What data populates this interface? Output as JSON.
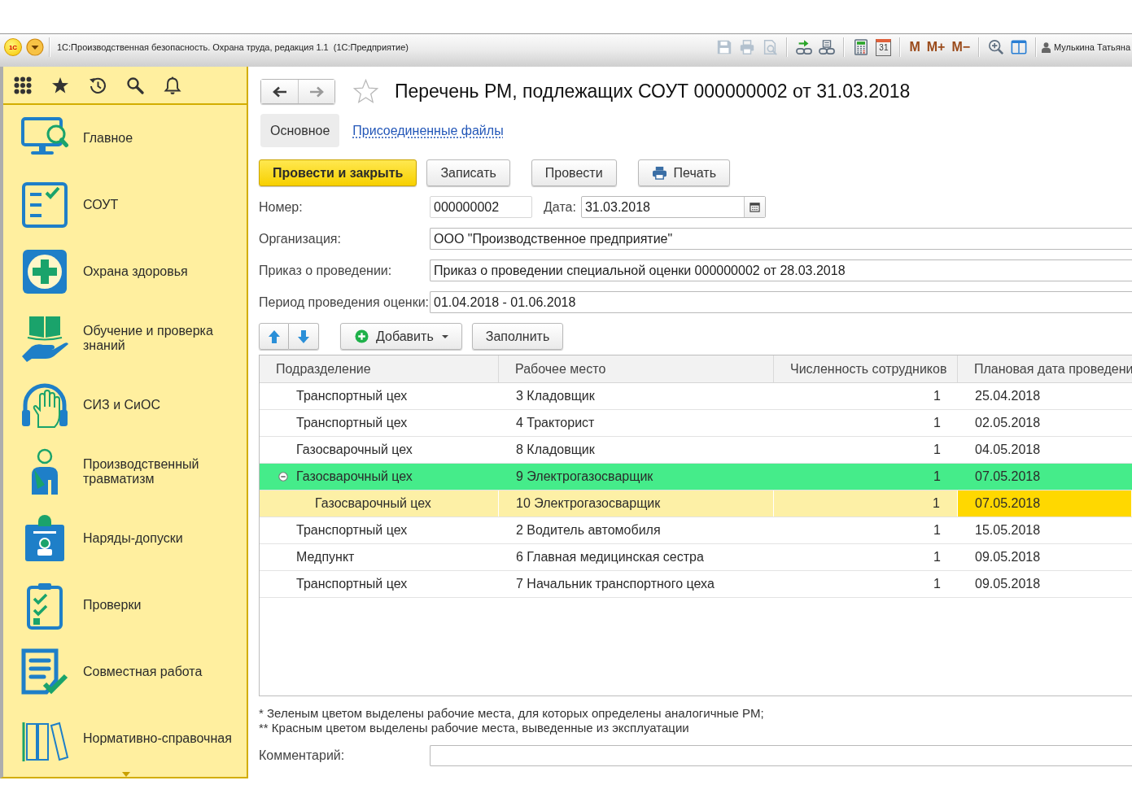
{
  "window": {
    "logo": "1С",
    "title": "1С:Производственная безопасность. Охрана труда, редакция 1.1  (1С:Предприятие)",
    "toolbar": [
      {
        "kind": "save",
        "disabled": true
      },
      {
        "kind": "print",
        "disabled": true
      },
      {
        "kind": "preview",
        "disabled": true
      },
      {
        "kind": "link-in",
        "disabled": false
      },
      {
        "kind": "link-print",
        "disabled": false
      },
      {
        "kind": "calculator",
        "disabled": false
      },
      {
        "kind": "calendar",
        "label": "31",
        "disabled": false
      },
      {
        "kind": "memory",
        "label": "M",
        "disabled": false
      },
      {
        "kind": "memory",
        "label": "M+",
        "disabled": false
      },
      {
        "kind": "memory",
        "label": "M−",
        "disabled": false
      },
      {
        "kind": "zoom",
        "disabled": false
      },
      {
        "kind": "panels",
        "disabled": false
      }
    ],
    "user": "Мулькина Татьяна"
  },
  "sidebar": {
    "sections": [
      {
        "kind": "monitor",
        "label": "Главное"
      },
      {
        "kind": "checklist",
        "label": "СОУТ"
      },
      {
        "kind": "health",
        "label": "Охрана здоровья"
      },
      {
        "kind": "book",
        "label": "Обучение и проверка знаний"
      },
      {
        "kind": "ppe",
        "label": "СИЗ и СиОС"
      },
      {
        "kind": "injury",
        "label": "Производственный травматизм"
      },
      {
        "kind": "permit",
        "label": "Наряды-допуски"
      },
      {
        "kind": "inspection",
        "label": "Проверки"
      },
      {
        "kind": "teamwork",
        "label": "Совместная работа"
      },
      {
        "kind": "reference",
        "label": "Нормативно-справочная"
      }
    ]
  },
  "form": {
    "nav": [
      {
        "kind": "back",
        "disabled": false
      },
      {
        "kind": "forward",
        "disabled": true
      }
    ],
    "favorite": false,
    "title": "Перечень РМ, подлежащих СОУТ 000000002 от 31.03.2018",
    "tabs": [
      {
        "label": "Основное",
        "selected": true
      },
      {
        "label": "Присоединенные файлы",
        "selected": false
      }
    ],
    "commands": [
      {
        "kind": "default",
        "label": "Провести и закрыть"
      },
      {
        "kind": "plain",
        "label": "Записать"
      },
      {
        "kind": "plain",
        "label": "Провести"
      },
      {
        "kind": "print",
        "label": "Печать"
      }
    ],
    "fields": {
      "number": {
        "label": "Номер:",
        "value": "000000002"
      },
      "date": {
        "label": "Дата:",
        "value": "31.03.2018"
      },
      "organization": {
        "label": "Организация:",
        "value": "ООО \"Производственное предприятие\""
      },
      "order": {
        "label": "Приказ о проведении:",
        "value": "Приказ о проведении специальной оценки 000000002 от 28.03.2018"
      },
      "period": {
        "label": "Период проведения оценки:",
        "value": "01.04.2018 - 01.06.2018"
      }
    },
    "table_toolbar": [
      {
        "kind": "up"
      },
      {
        "kind": "down"
      },
      {
        "kind": "add",
        "label": "Добавить"
      },
      {
        "kind": "fill",
        "label": "Заполнить"
      }
    ],
    "table": {
      "columns": [
        {
          "label": "Подразделение",
          "current": false
        },
        {
          "label": "Рабочее место",
          "current": false
        },
        {
          "label": "Численность сотрудников",
          "current": false
        },
        {
          "label": "Плановая дата проведени",
          "current": true
        }
      ],
      "rows": [
        {
          "cells": [
            "Транспортный цех",
            "3 Кладовщик",
            "1",
            "25.04.2018"
          ],
          "selected": false,
          "analogous": false
        },
        {
          "cells": [
            "Транспортный цех",
            "4 Тракторист",
            "1",
            "02.05.2018"
          ],
          "selected": false,
          "analogous": false
        },
        {
          "cells": [
            "Газосварочный цех",
            "8 Кладовщик",
            "1",
            "04.05.2018"
          ],
          "selected": false,
          "analogous": false
        },
        {
          "cells": [
            "Газосварочный цех",
            "9 Электрогазосварщик",
            "1",
            "07.05.2018"
          ],
          "selected": false,
          "analogous": true,
          "expanded": true,
          "children": [
            {
              "cells": [
                "Газосварочный цех",
                "10 Электрогазосварщик",
                "1",
                "07.05.2018"
              ],
              "selected": true,
              "analogous": false
            }
          ]
        },
        {
          "cells": [
            "Транспортный цех",
            "2 Водитель автомобиля",
            "1",
            "15.05.2018"
          ],
          "selected": false,
          "analogous": false
        },
        {
          "cells": [
            "Медпункт",
            "6 Главная медицинская сестра",
            "1",
            "09.05.2018"
          ],
          "selected": false,
          "analogous": false
        },
        {
          "cells": [
            "Транспортный цех",
            "7 Начальник транспортного цеха",
            "1",
            "09.05.2018"
          ],
          "selected": false,
          "analogous": false
        }
      ]
    },
    "footnotes": [
      "* Зеленым цветом выделены рабочие места, для которых определены аналогичные РМ;",
      "** Красным цветом выделены рабочие места, выведенные из эксплуатации"
    ],
    "comment": {
      "label": "Комментарий:"
    }
  }
}
